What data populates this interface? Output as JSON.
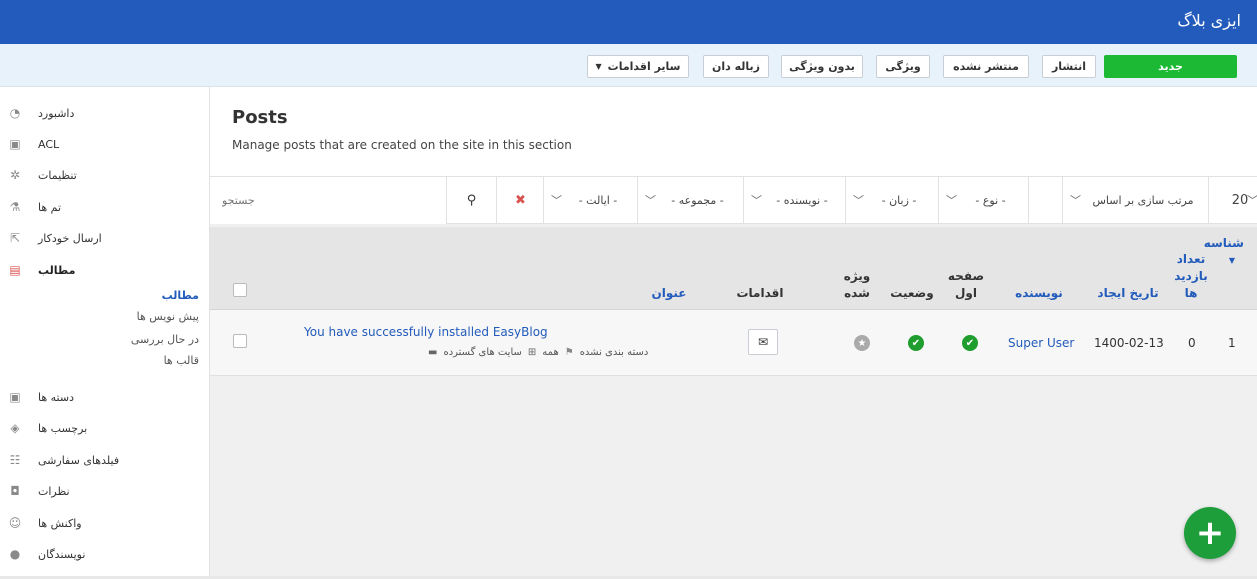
{
  "app": {
    "title": "ایزی بلاگ"
  },
  "toolbar": {
    "new_label": "جدید",
    "publish_label": "انتشار",
    "unpublish_label": "منتشر نشده",
    "feature_label": "ویژگی",
    "unfeature_label": "بدون ویژگی",
    "trash_label": "زباله دان",
    "more_actions_label": "سایر اقدامات"
  },
  "sidebar": {
    "items": [
      {
        "label": "داشبورد",
        "icon": "dashboard-icon"
      },
      {
        "label": "ACL",
        "icon": "lock-icon"
      },
      {
        "label": "تنظیمات",
        "icon": "gear-icon"
      },
      {
        "label": "تم ها",
        "icon": "flask-icon"
      },
      {
        "label": "ارسال خودکار",
        "icon": "share-icon"
      },
      {
        "label": "مطالب",
        "icon": "document-icon"
      },
      {
        "label": "دسته ها",
        "icon": "archive-icon"
      },
      {
        "label": "برچسب ها",
        "icon": "tags-icon"
      },
      {
        "label": "فیلدهای سفارشی",
        "icon": "list-icon"
      },
      {
        "label": "نظرات",
        "icon": "comments-icon"
      },
      {
        "label": "واکنش ها",
        "icon": "smile-icon"
      },
      {
        "label": "نویسندگان",
        "icon": "user-icon"
      }
    ],
    "subitems": [
      "مطالب",
      "پیش نویس ها",
      "در حال بررسی",
      "قالب ها"
    ]
  },
  "main": {
    "title": "Posts",
    "description": "Manage posts that are created on the site in this section"
  },
  "filters": {
    "search_placeholder": "جستجو",
    "state": "- ایالت -",
    "collection": "- مجموعه -",
    "author": "- نویسنده -",
    "language": "- زبان -",
    "type": "- نوع -",
    "sort": "مرتب سازی بر اساس",
    "limit": "20"
  },
  "table": {
    "headers": {
      "title": "عنوان",
      "actions": "اقدامات",
      "featured": "ویژه شده",
      "status": "وضعیت",
      "frontpage": "صفحه اول",
      "author": "نویسنده",
      "created": "تاریخ ایجاد",
      "hits": "تعداد بازدید ها",
      "id": "شناسه"
    },
    "rows": [
      {
        "title": "You have successfully installed EasyBlog",
        "category": "دسته بندی نشده",
        "access": "همه",
        "site": "سایت های گسترده",
        "author": "Super User",
        "created": "1400-02-13",
        "hits": "0",
        "id": "1"
      }
    ]
  },
  "colors": {
    "topbar": "#225bbb",
    "primary_green": "#1bb934",
    "fab": "#1e9e3a"
  }
}
